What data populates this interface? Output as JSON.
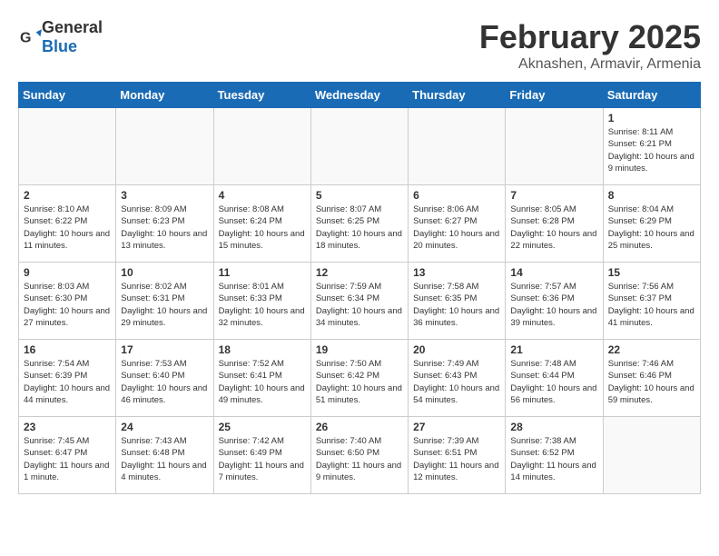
{
  "logo": {
    "general": "General",
    "blue": "Blue"
  },
  "header": {
    "month": "February 2025",
    "location": "Aknashen, Armavir, Armenia"
  },
  "days_of_week": [
    "Sunday",
    "Monday",
    "Tuesday",
    "Wednesday",
    "Thursday",
    "Friday",
    "Saturday"
  ],
  "weeks": [
    [
      {
        "day": "",
        "info": ""
      },
      {
        "day": "",
        "info": ""
      },
      {
        "day": "",
        "info": ""
      },
      {
        "day": "",
        "info": ""
      },
      {
        "day": "",
        "info": ""
      },
      {
        "day": "",
        "info": ""
      },
      {
        "day": "1",
        "info": "Sunrise: 8:11 AM\nSunset: 6:21 PM\nDaylight: 10 hours\nand 9 minutes."
      }
    ],
    [
      {
        "day": "2",
        "info": "Sunrise: 8:10 AM\nSunset: 6:22 PM\nDaylight: 10 hours\nand 11 minutes."
      },
      {
        "day": "3",
        "info": "Sunrise: 8:09 AM\nSunset: 6:23 PM\nDaylight: 10 hours\nand 13 minutes."
      },
      {
        "day": "4",
        "info": "Sunrise: 8:08 AM\nSunset: 6:24 PM\nDaylight: 10 hours\nand 15 minutes."
      },
      {
        "day": "5",
        "info": "Sunrise: 8:07 AM\nSunset: 6:25 PM\nDaylight: 10 hours\nand 18 minutes."
      },
      {
        "day": "6",
        "info": "Sunrise: 8:06 AM\nSunset: 6:27 PM\nDaylight: 10 hours\nand 20 minutes."
      },
      {
        "day": "7",
        "info": "Sunrise: 8:05 AM\nSunset: 6:28 PM\nDaylight: 10 hours\nand 22 minutes."
      },
      {
        "day": "8",
        "info": "Sunrise: 8:04 AM\nSunset: 6:29 PM\nDaylight: 10 hours\nand 25 minutes."
      }
    ],
    [
      {
        "day": "9",
        "info": "Sunrise: 8:03 AM\nSunset: 6:30 PM\nDaylight: 10 hours\nand 27 minutes."
      },
      {
        "day": "10",
        "info": "Sunrise: 8:02 AM\nSunset: 6:31 PM\nDaylight: 10 hours\nand 29 minutes."
      },
      {
        "day": "11",
        "info": "Sunrise: 8:01 AM\nSunset: 6:33 PM\nDaylight: 10 hours\nand 32 minutes."
      },
      {
        "day": "12",
        "info": "Sunrise: 7:59 AM\nSunset: 6:34 PM\nDaylight: 10 hours\nand 34 minutes."
      },
      {
        "day": "13",
        "info": "Sunrise: 7:58 AM\nSunset: 6:35 PM\nDaylight: 10 hours\nand 36 minutes."
      },
      {
        "day": "14",
        "info": "Sunrise: 7:57 AM\nSunset: 6:36 PM\nDaylight: 10 hours\nand 39 minutes."
      },
      {
        "day": "15",
        "info": "Sunrise: 7:56 AM\nSunset: 6:37 PM\nDaylight: 10 hours\nand 41 minutes."
      }
    ],
    [
      {
        "day": "16",
        "info": "Sunrise: 7:54 AM\nSunset: 6:39 PM\nDaylight: 10 hours\nand 44 minutes."
      },
      {
        "day": "17",
        "info": "Sunrise: 7:53 AM\nSunset: 6:40 PM\nDaylight: 10 hours\nand 46 minutes."
      },
      {
        "day": "18",
        "info": "Sunrise: 7:52 AM\nSunset: 6:41 PM\nDaylight: 10 hours\nand 49 minutes."
      },
      {
        "day": "19",
        "info": "Sunrise: 7:50 AM\nSunset: 6:42 PM\nDaylight: 10 hours\nand 51 minutes."
      },
      {
        "day": "20",
        "info": "Sunrise: 7:49 AM\nSunset: 6:43 PM\nDaylight: 10 hours\nand 54 minutes."
      },
      {
        "day": "21",
        "info": "Sunrise: 7:48 AM\nSunset: 6:44 PM\nDaylight: 10 hours\nand 56 minutes."
      },
      {
        "day": "22",
        "info": "Sunrise: 7:46 AM\nSunset: 6:46 PM\nDaylight: 10 hours\nand 59 minutes."
      }
    ],
    [
      {
        "day": "23",
        "info": "Sunrise: 7:45 AM\nSunset: 6:47 PM\nDaylight: 11 hours\nand 1 minute."
      },
      {
        "day": "24",
        "info": "Sunrise: 7:43 AM\nSunset: 6:48 PM\nDaylight: 11 hours\nand 4 minutes."
      },
      {
        "day": "25",
        "info": "Sunrise: 7:42 AM\nSunset: 6:49 PM\nDaylight: 11 hours\nand 7 minutes."
      },
      {
        "day": "26",
        "info": "Sunrise: 7:40 AM\nSunset: 6:50 PM\nDaylight: 11 hours\nand 9 minutes."
      },
      {
        "day": "27",
        "info": "Sunrise: 7:39 AM\nSunset: 6:51 PM\nDaylight: 11 hours\nand 12 minutes."
      },
      {
        "day": "28",
        "info": "Sunrise: 7:38 AM\nSunset: 6:52 PM\nDaylight: 11 hours\nand 14 minutes."
      },
      {
        "day": "",
        "info": ""
      }
    ]
  ]
}
